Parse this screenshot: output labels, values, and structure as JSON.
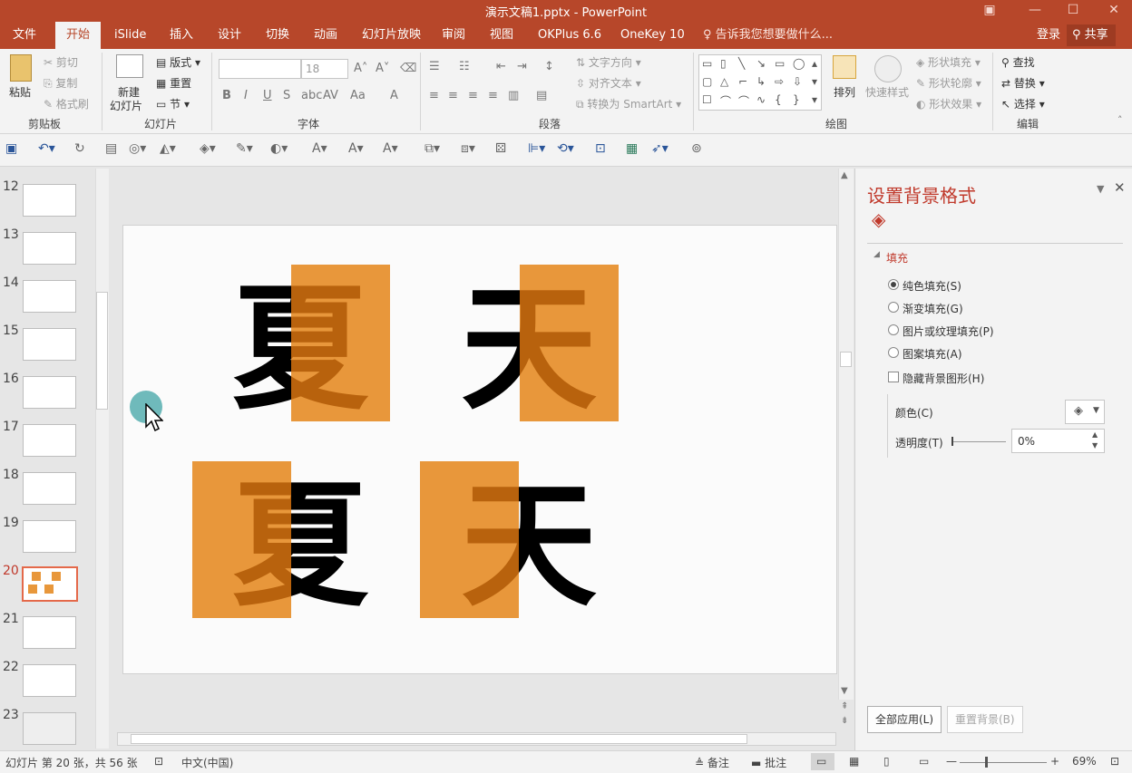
{
  "window": {
    "title": "演示文稿1.pptx - PowerPoint"
  },
  "tabs": [
    {
      "label": "文件"
    },
    {
      "label": "开始"
    },
    {
      "label": "iSlide"
    },
    {
      "label": "插入"
    },
    {
      "label": "设计"
    },
    {
      "label": "切换"
    },
    {
      "label": "动画"
    },
    {
      "label": "幻灯片放映"
    },
    {
      "label": "审阅"
    },
    {
      "label": "视图"
    },
    {
      "label": "OKPlus 6.6"
    },
    {
      "label": "OneKey 10"
    }
  ],
  "tell_me": "告诉我您想要做什么...",
  "account": {
    "login": "登录",
    "share": "共享"
  },
  "ribbon": {
    "clipboard": {
      "paste": "粘贴",
      "cut": "剪切",
      "copy": "复制",
      "format_painter": "格式刷",
      "label": "剪贴板"
    },
    "slides": {
      "new_slide_1": "新建",
      "new_slide_2": "幻灯片",
      "layout": "版式",
      "reset": "重置",
      "section": "节",
      "label": "幻灯片"
    },
    "font": {
      "size": "18",
      "label": "字体"
    },
    "paragraph": {
      "text_direction": "文字方向",
      "align_text": "对齐文本",
      "smartart": "转换为 SmartArt",
      "label": "段落"
    },
    "drawing": {
      "arrange": "排列",
      "quick_styles": "快速样式",
      "shape_fill": "形状填充",
      "shape_outline": "形状轮廓",
      "shape_effects": "形状效果",
      "label": "绘图"
    },
    "editing": {
      "find": "查找",
      "replace": "替换",
      "select": "选择",
      "label": "编辑"
    }
  },
  "thumbnails": [
    {
      "num": "12"
    },
    {
      "num": "13"
    },
    {
      "num": "14"
    },
    {
      "num": "15"
    },
    {
      "num": "16"
    },
    {
      "num": "17"
    },
    {
      "num": "18"
    },
    {
      "num": "19"
    },
    {
      "num": "20"
    },
    {
      "num": "21"
    },
    {
      "num": "22"
    },
    {
      "num": "23"
    }
  ],
  "slide": {
    "char1": "夏",
    "char2": "天"
  },
  "pane": {
    "title": "设置背景格式",
    "section": "填充",
    "options": [
      {
        "label": "纯色填充(S)",
        "selected": true
      },
      {
        "label": "渐变填充(G)",
        "selected": false
      },
      {
        "label": "图片或纹理填充(P)",
        "selected": false
      },
      {
        "label": "图案填充(A)",
        "selected": false
      }
    ],
    "hide_bg": "隐藏背景图形(H)",
    "color_label": "颜色(C)",
    "transparency_label": "透明度(T)",
    "transparency_value": "0%",
    "apply_all": "全部应用(L)",
    "reset_bg": "重置背景(B)"
  },
  "status": {
    "slide_info": "幻灯片 第 20 张，共 56 张",
    "language": "中文(中国)",
    "notes": "备注",
    "comments": "批注",
    "zoom": "69%"
  },
  "colors": {
    "accent": "#b7472a",
    "shape_fill": "#e8973b",
    "overlap_text": "#b8620d"
  }
}
